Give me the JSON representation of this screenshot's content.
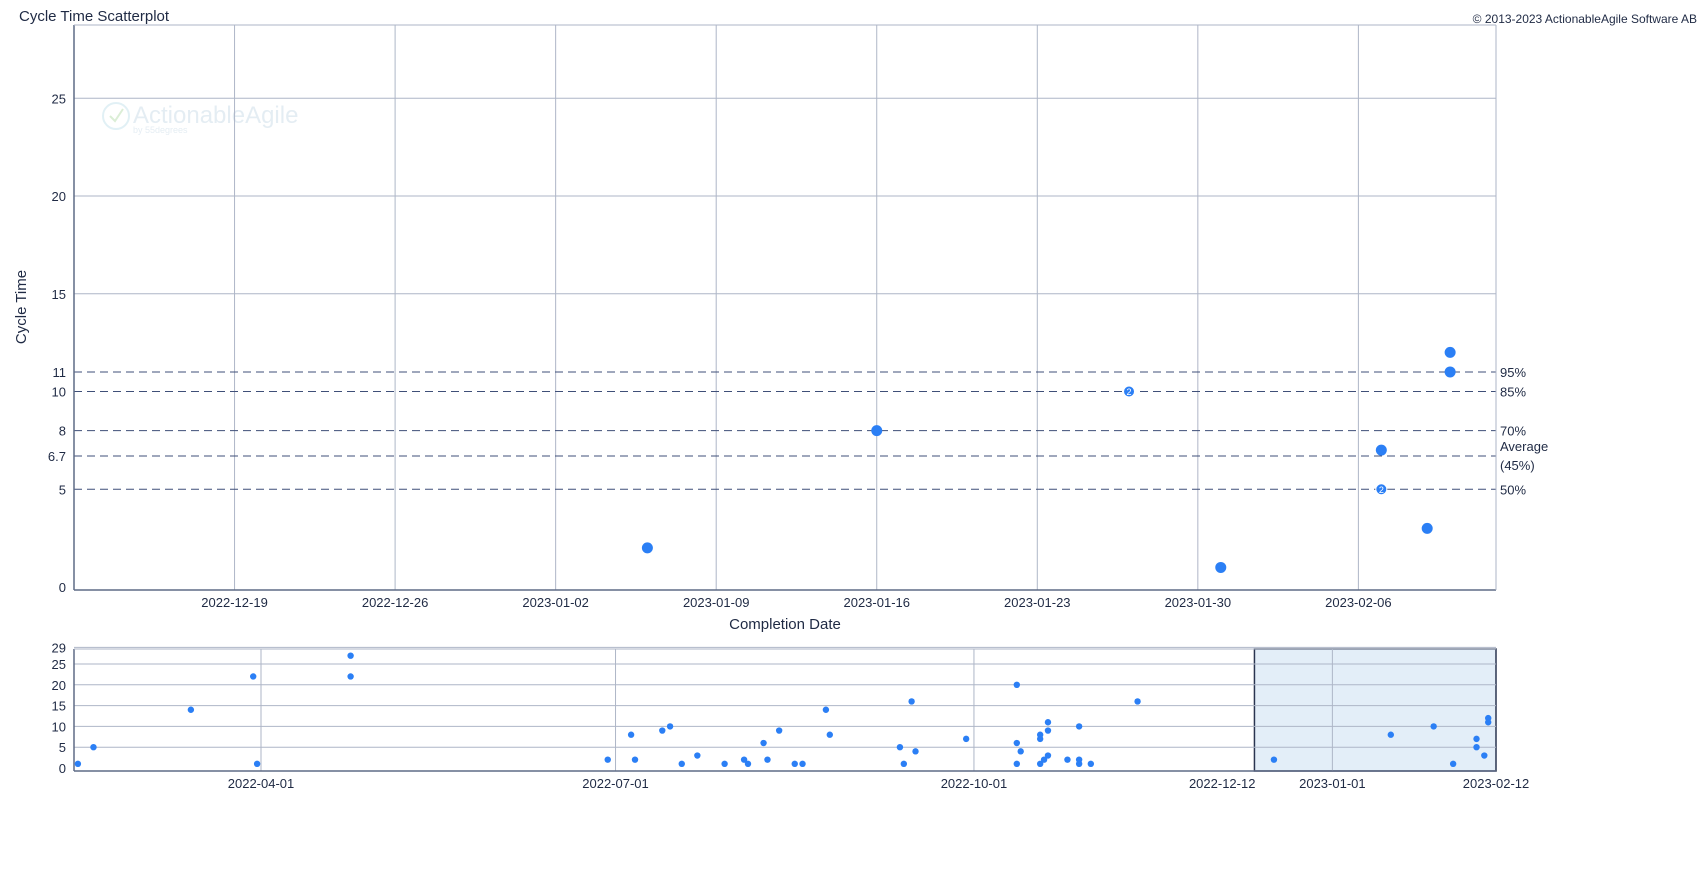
{
  "header": {
    "title": "Cycle Time Scatterplot",
    "copyright": "© 2013-2023 ActionableAgile Software AB"
  },
  "watermark": {
    "brand": "ActionableAgile",
    "sub": "by 55degrees"
  },
  "colors": {
    "point": "#2b7ff5",
    "grid": "#aeb6c7",
    "axis": "#5f6b85",
    "percentile_line": "#3f4f78",
    "brush_fill": "#e3eef8",
    "brush_stroke": "#2a3550"
  },
  "chart_data": [
    {
      "type": "scatter",
      "xlabel": "Completion Date",
      "ylabel": "Cycle Time",
      "xlim": [
        "2022-12-12",
        "2023-02-12"
      ],
      "ylim": [
        0,
        29
      ],
      "x_ticks": [
        "2022-12-19",
        "2022-12-26",
        "2023-01-02",
        "2023-01-09",
        "2023-01-16",
        "2023-01-23",
        "2023-01-30",
        "2023-02-06"
      ],
      "y_ticks": [
        0,
        5,
        6.7,
        8,
        10,
        11,
        15,
        20,
        25
      ],
      "grid": true,
      "percentiles": [
        {
          "value": 11,
          "label": "95%"
        },
        {
          "value": 10,
          "label": "85%"
        },
        {
          "value": 8,
          "label": "70%"
        },
        {
          "value": 6.7,
          "label": "Average (45%)"
        },
        {
          "value": 5,
          "label": "50%"
        }
      ],
      "points": [
        {
          "x": "2023-01-06",
          "y": 2
        },
        {
          "x": "2023-01-16",
          "y": 8
        },
        {
          "x": "2023-01-27",
          "y": 10,
          "count": "2"
        },
        {
          "x": "2023-01-31",
          "y": 1
        },
        {
          "x": "2023-02-07",
          "y": 7
        },
        {
          "x": "2023-02-07",
          "y": 5,
          "count": "2"
        },
        {
          "x": "2023-02-09",
          "y": 3
        },
        {
          "x": "2023-02-10",
          "y": 11
        },
        {
          "x": "2023-02-10",
          "y": 12
        }
      ]
    },
    {
      "type": "scatter",
      "xlim": [
        "2022-02-12",
        "2023-02-12"
      ],
      "ylim": [
        0,
        29
      ],
      "x_ticks": [
        "2022-04-01",
        "2022-07-01",
        "2022-10-01",
        "2022-12-12",
        "2023-01-01",
        "2023-02-12"
      ],
      "y_ticks": [
        0,
        5,
        10,
        15,
        20,
        25,
        29
      ],
      "grid": true,
      "brush": [
        "2022-12-12",
        "2023-02-12"
      ],
      "points": [
        {
          "x": "2022-02-13",
          "y": 1
        },
        {
          "x": "2022-02-17",
          "y": 5
        },
        {
          "x": "2022-03-14",
          "y": 14
        },
        {
          "x": "2022-03-30",
          "y": 22
        },
        {
          "x": "2022-03-31",
          "y": 1
        },
        {
          "x": "2022-04-24",
          "y": 27
        },
        {
          "x": "2022-04-24",
          "y": 22
        },
        {
          "x": "2022-06-29",
          "y": 2
        },
        {
          "x": "2022-07-05",
          "y": 8
        },
        {
          "x": "2022-07-06",
          "y": 2
        },
        {
          "x": "2022-07-13",
          "y": 9
        },
        {
          "x": "2022-07-15",
          "y": 10
        },
        {
          "x": "2022-07-18",
          "y": 1
        },
        {
          "x": "2022-07-22",
          "y": 3
        },
        {
          "x": "2022-07-29",
          "y": 1
        },
        {
          "x": "2022-08-03",
          "y": 2
        },
        {
          "x": "2022-08-04",
          "y": 1
        },
        {
          "x": "2022-08-08",
          "y": 6
        },
        {
          "x": "2022-08-09",
          "y": 2
        },
        {
          "x": "2022-08-12",
          "y": 9
        },
        {
          "x": "2022-08-16",
          "y": 1
        },
        {
          "x": "2022-08-18",
          "y": 1
        },
        {
          "x": "2022-08-24",
          "y": 14
        },
        {
          "x": "2022-08-25",
          "y": 8
        },
        {
          "x": "2022-09-12",
          "y": 5
        },
        {
          "x": "2022-09-13",
          "y": 1
        },
        {
          "x": "2022-09-15",
          "y": 16
        },
        {
          "x": "2022-09-16",
          "y": 4
        },
        {
          "x": "2022-09-29",
          "y": 7
        },
        {
          "x": "2022-10-12",
          "y": 20
        },
        {
          "x": "2022-10-12",
          "y": 6
        },
        {
          "x": "2022-10-12",
          "y": 1
        },
        {
          "x": "2022-10-13",
          "y": 4
        },
        {
          "x": "2022-10-18",
          "y": 1
        },
        {
          "x": "2022-10-18",
          "y": 8
        },
        {
          "x": "2022-10-18",
          "y": 7
        },
        {
          "x": "2022-10-19",
          "y": 2
        },
        {
          "x": "2022-10-20",
          "y": 11
        },
        {
          "x": "2022-10-20",
          "y": 9
        },
        {
          "x": "2022-10-20",
          "y": 3
        },
        {
          "x": "2022-10-25",
          "y": 2
        },
        {
          "x": "2022-10-28",
          "y": 10
        },
        {
          "x": "2022-10-28",
          "y": 2
        },
        {
          "x": "2022-10-28",
          "y": 1
        },
        {
          "x": "2022-10-31",
          "y": 1
        },
        {
          "x": "2022-11-12",
          "y": 16
        },
        {
          "x": "2022-12-17",
          "y": 2
        },
        {
          "x": "2023-01-16",
          "y": 8
        },
        {
          "x": "2023-01-27",
          "y": 10
        },
        {
          "x": "2023-02-01",
          "y": 1
        },
        {
          "x": "2023-02-07",
          "y": 7
        },
        {
          "x": "2023-02-07",
          "y": 5
        },
        {
          "x": "2023-02-09",
          "y": 3
        },
        {
          "x": "2023-02-10",
          "y": 12
        },
        {
          "x": "2023-02-10",
          "y": 11
        }
      ]
    }
  ]
}
